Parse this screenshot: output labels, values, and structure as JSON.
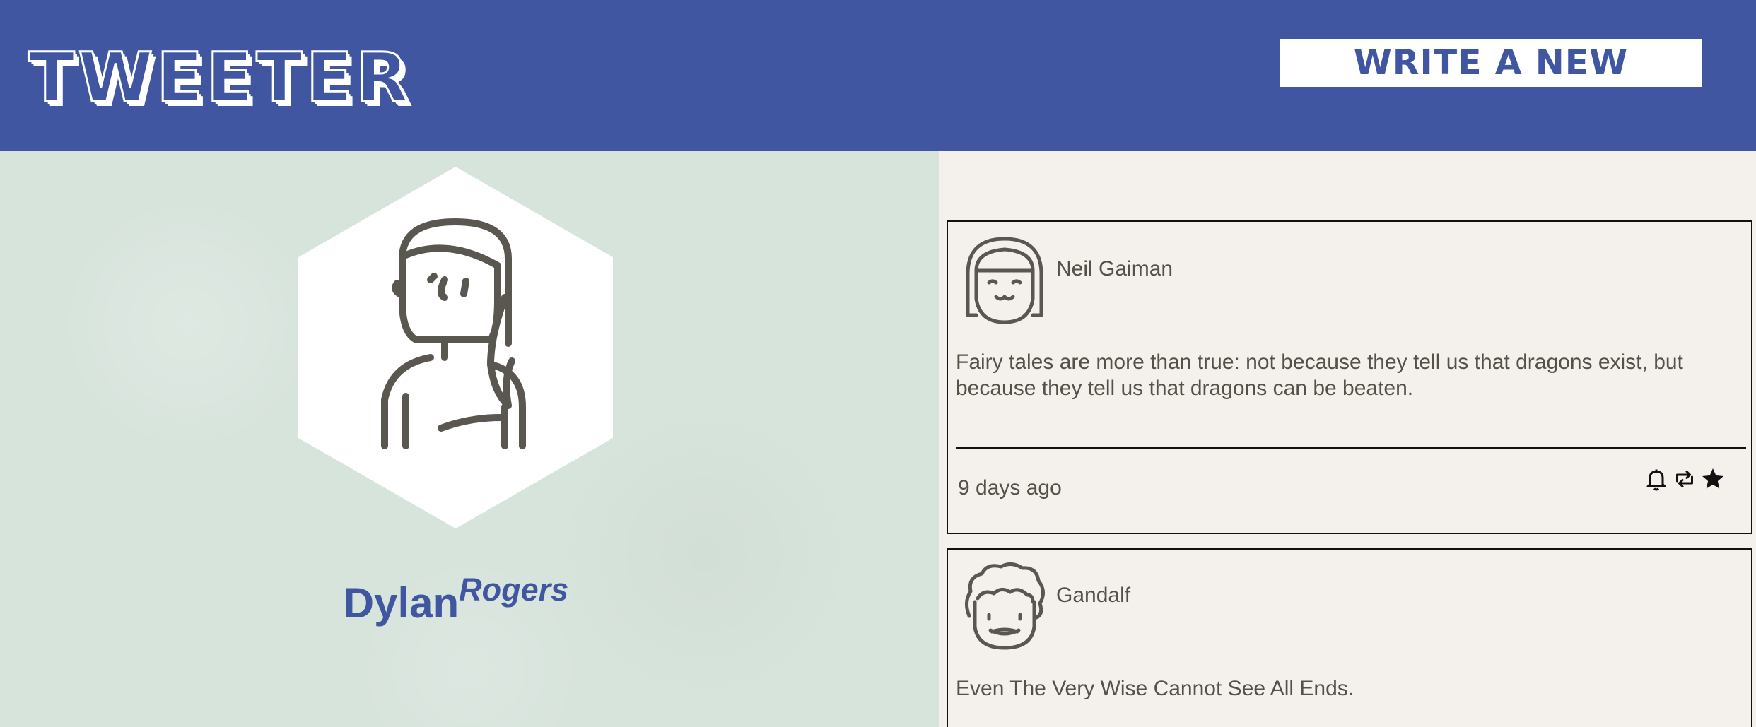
{
  "header": {
    "brand": "TWEETER",
    "write_button": "WRITE A NEW TWEET",
    "background": "#4056a1"
  },
  "profile": {
    "first_name": "Dylan",
    "last_name": "Rogers",
    "avatar_icon": "woman-avatar-icon",
    "name_color": "#4056a1"
  },
  "tweets": [
    {
      "author": "Neil Gaiman",
      "avatar_icon": "girl-bangs-avatar-icon",
      "text": "Fairy tales are more than true: not because they tell us that dragons exist, but because they tell us that dragons can be beaten.",
      "time": "9 days ago",
      "actions": [
        "bell-icon",
        "retweet-icon",
        "star-icon"
      ]
    },
    {
      "author": "Gandalf",
      "avatar_icon": "curly-hair-avatar-icon",
      "text": "Even The Very Wise Cannot See All Ends."
    }
  ]
}
